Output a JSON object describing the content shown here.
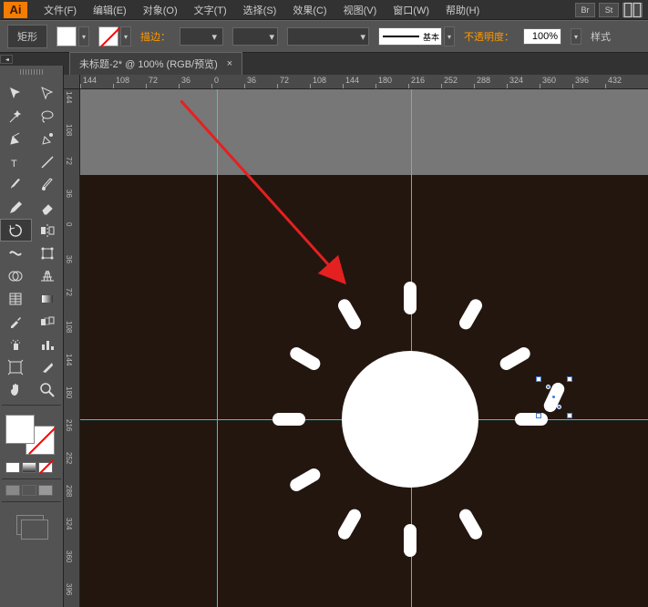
{
  "app": {
    "logo": "Ai"
  },
  "menu": {
    "file": "文件(F)",
    "edit": "编辑(E)",
    "object": "对象(O)",
    "type": "文字(T)",
    "select": "选择(S)",
    "effect": "效果(C)",
    "view": "视图(V)",
    "window": "窗口(W)",
    "help": "帮助(H)"
  },
  "hdr": {
    "br": "Br",
    "st": "St"
  },
  "ctl": {
    "shape": "矩形",
    "stroke_label": "描边：",
    "basic": "基本",
    "opacity_label": "不透明度：",
    "opacity_value": "100%",
    "style": "样式"
  },
  "tab": {
    "title": "未标题-2* @ 100% (RGB/预览)",
    "close": "×"
  },
  "ruler_h": [
    "144",
    "108",
    "72",
    "36",
    "0",
    "36",
    "72",
    "108",
    "144",
    "180",
    "216",
    "252",
    "288",
    "324",
    "360",
    "396",
    "432"
  ],
  "ruler_v": [
    "144",
    "108",
    "72",
    "36",
    "0",
    "36",
    "72",
    "108",
    "144",
    "180",
    "216",
    "252",
    "288",
    "324",
    "360",
    "396"
  ]
}
